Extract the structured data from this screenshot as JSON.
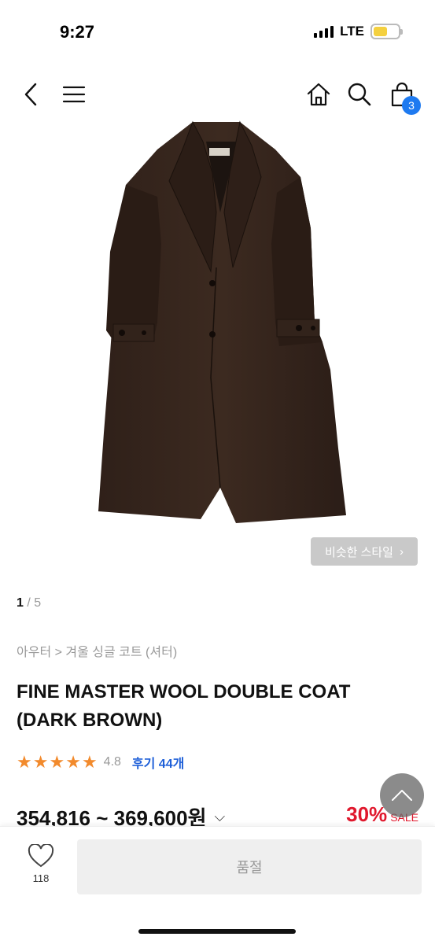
{
  "status_bar": {
    "time": "9:27",
    "network": "LTE",
    "battery_color": "#f4d03f"
  },
  "nav": {
    "back_icon": "chevron-left-icon",
    "menu_icon": "hamburger-menu-icon",
    "home_icon": "home-icon",
    "search_icon": "search-icon",
    "cart_icon": "shopping-bag-icon",
    "cart_count": "3"
  },
  "gallery": {
    "similar_style_label": "비슷한 스타일",
    "current_page": "1",
    "page_separator": "/",
    "total_pages": "5"
  },
  "product": {
    "breadcrumb": "아우터 > 겨울 싱글 코트 (셔터)",
    "title": "FINE MASTER WOOL DOUBLE COAT (DARK BROWN)",
    "rating": "4.8",
    "review_label": "후기 44개",
    "price_range": "354,816 ~ 369,600원",
    "discount": "30%",
    "sale_label": "SALE"
  },
  "bottom_bar": {
    "like_count": "118",
    "soldout_label": "품절"
  },
  "colors": {
    "accent_blue": "#1e7af0",
    "sale_red": "#e0182d",
    "star_orange": "#f28a2c"
  }
}
